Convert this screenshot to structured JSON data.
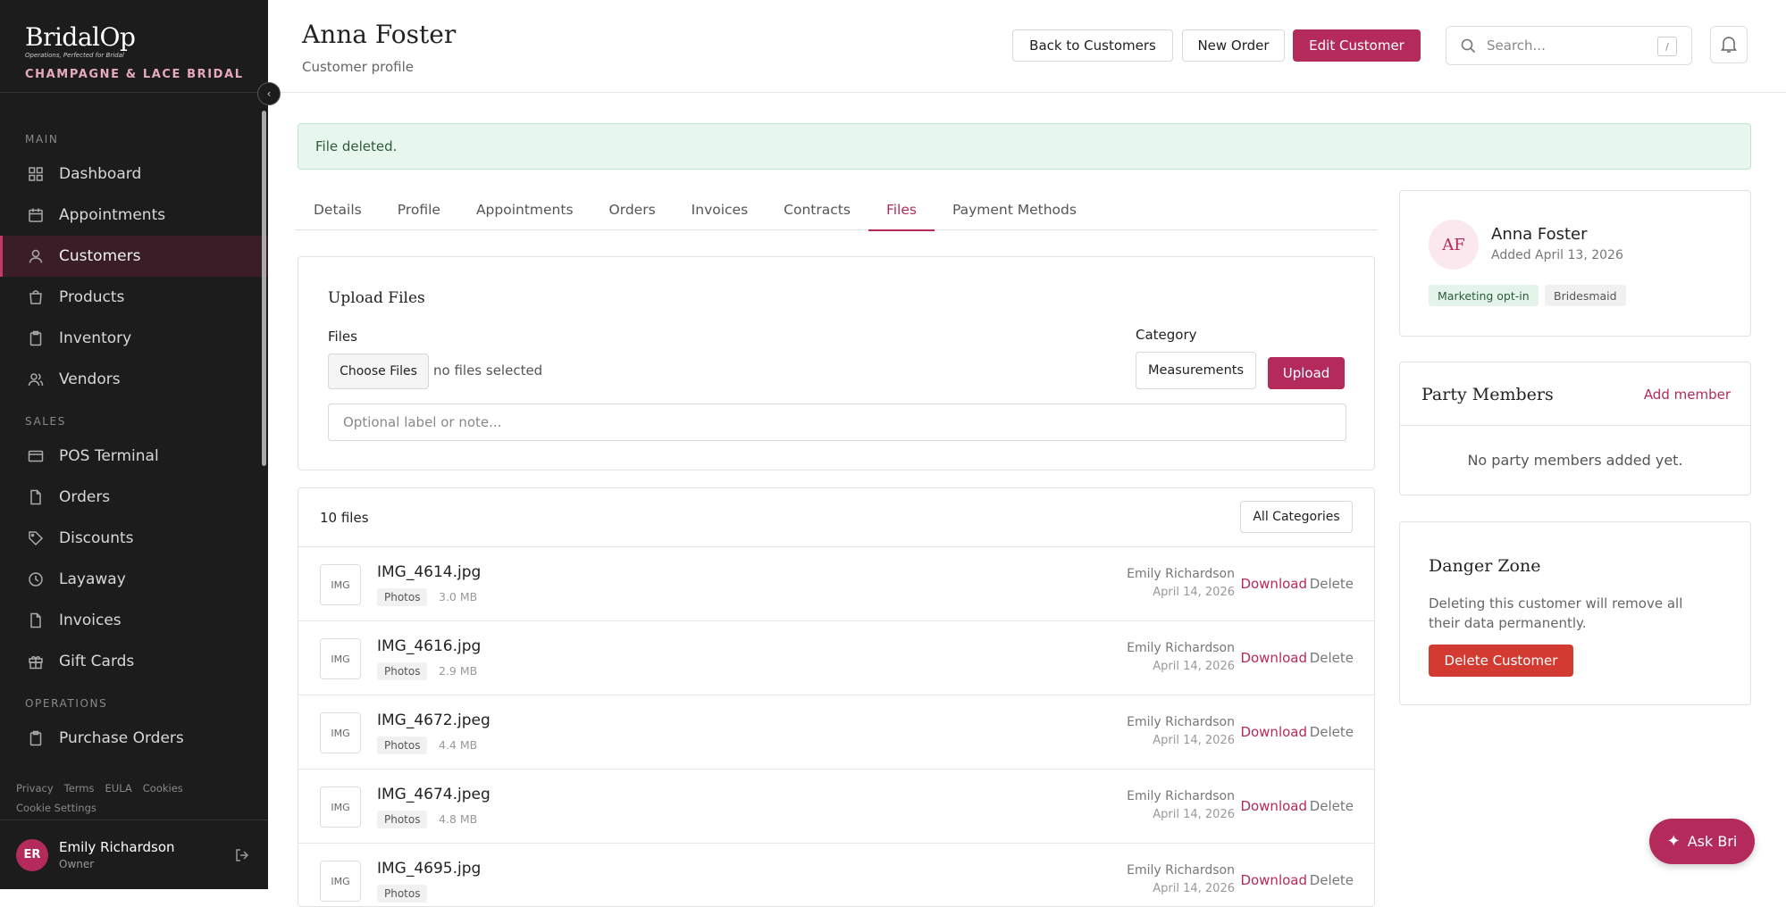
{
  "brand": {
    "name": "BridalOp",
    "tagline": "Operations, Perfected for Bridal",
    "store": "CHAMPAGNE & LACE BRIDAL"
  },
  "sidebar": {
    "sections": [
      {
        "label": "MAIN",
        "items": [
          {
            "label": "Dashboard",
            "icon": "grid-icon"
          },
          {
            "label": "Appointments",
            "icon": "calendar-icon"
          },
          {
            "label": "Customers",
            "icon": "user-icon",
            "active": true
          },
          {
            "label": "Products",
            "icon": "bag-icon"
          },
          {
            "label": "Inventory",
            "icon": "clipboard-icon"
          },
          {
            "label": "Vendors",
            "icon": "users-icon"
          }
        ]
      },
      {
        "label": "SALES",
        "items": [
          {
            "label": "POS Terminal",
            "icon": "card-icon"
          },
          {
            "label": "Orders",
            "icon": "document-icon"
          },
          {
            "label": "Discounts",
            "icon": "tag-icon"
          },
          {
            "label": "Layaway",
            "icon": "clock-icon"
          },
          {
            "label": "Invoices",
            "icon": "document-icon"
          },
          {
            "label": "Gift Cards",
            "icon": "gift-icon"
          }
        ]
      },
      {
        "label": "OPERATIONS",
        "items": [
          {
            "label": "Purchase Orders",
            "icon": "clipboard-icon"
          }
        ]
      }
    ],
    "footer_links": [
      "Privacy",
      "Terms",
      "EULA",
      "Cookies",
      "Cookie Settings"
    ],
    "user": {
      "initials": "ER",
      "name": "Emily Richardson",
      "role": "Owner"
    }
  },
  "header": {
    "title": "Anna Foster",
    "subtitle": "Customer profile",
    "back_label": "Back to Customers",
    "new_order_label": "New Order",
    "edit_label": "Edit Customer",
    "search_placeholder": "Search...",
    "search_shortcut": "/"
  },
  "alert": {
    "text": "File deleted."
  },
  "tabs": [
    {
      "label": "Details"
    },
    {
      "label": "Profile"
    },
    {
      "label": "Appointments"
    },
    {
      "label": "Orders"
    },
    {
      "label": "Invoices"
    },
    {
      "label": "Contracts"
    },
    {
      "label": "Files",
      "active": true
    },
    {
      "label": "Payment Methods"
    }
  ],
  "upload": {
    "title": "Upload Files",
    "files_label": "Files",
    "choose_label": "Choose Files",
    "no_files": "no files selected",
    "category_label": "Category",
    "category_value": "Measurements",
    "upload_label": "Upload",
    "note_placeholder": "Optional label or note..."
  },
  "files": {
    "count_label": "10 files",
    "filter_value": "All Categories",
    "download_label": "Download",
    "delete_label": "Delete",
    "rows": [
      {
        "thumb": "IMG",
        "name": "IMG_4614.jpg",
        "category": "Photos",
        "size": "3.0 MB",
        "user": "Emily Richardson",
        "date": "April 14, 2026"
      },
      {
        "thumb": "IMG",
        "name": "IMG_4616.jpg",
        "category": "Photos",
        "size": "2.9 MB",
        "user": "Emily Richardson",
        "date": "April 14, 2026"
      },
      {
        "thumb": "IMG",
        "name": "IMG_4672.jpeg",
        "category": "Photos",
        "size": "4.4 MB",
        "user": "Emily Richardson",
        "date": "April 14, 2026"
      },
      {
        "thumb": "IMG",
        "name": "IMG_4674.jpeg",
        "category": "Photos",
        "size": "4.8 MB",
        "user": "Emily Richardson",
        "date": "April 14, 2026"
      },
      {
        "thumb": "IMG",
        "name": "IMG_4695.jpg",
        "category": "Photos",
        "size": "",
        "user": "Emily Richardson",
        "date": "April 14, 2026"
      }
    ]
  },
  "profile": {
    "initials": "AF",
    "name": "Anna Foster",
    "added": "Added April 13, 2026",
    "tags": [
      "Marketing opt-in",
      "Bridesmaid"
    ]
  },
  "party": {
    "title": "Party Members",
    "add_label": "Add member",
    "empty_text": "No party members added yet."
  },
  "danger": {
    "title": "Danger Zone",
    "text": "Deleting this customer will remove all their data permanently.",
    "button_label": "Delete Customer"
  },
  "assistant": {
    "label": "Ask Bri"
  },
  "colors": {
    "accent": "#b32a5b",
    "danger": "#d23a32",
    "sidebar_bg": "#1c1c1c",
    "success_bg": "#e8f7ee"
  }
}
